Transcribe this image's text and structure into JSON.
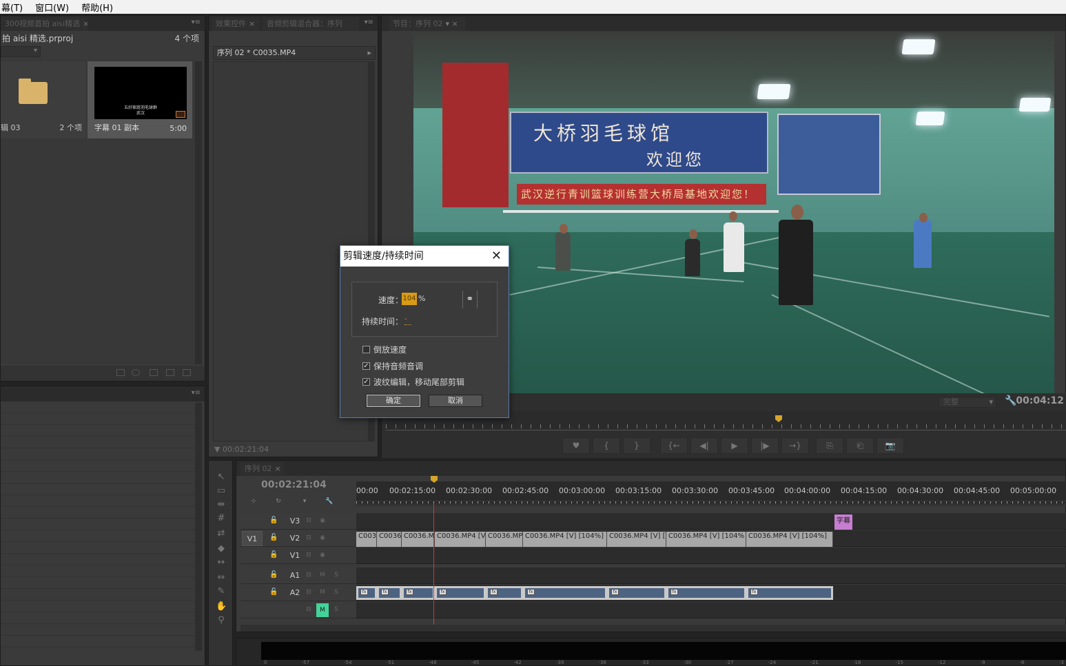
{
  "menubar": {
    "items": [
      "幕(T)",
      "窗口(W)",
      "帮助(H)"
    ]
  },
  "project": {
    "tab_label": "300视频首拍 aisi精选",
    "file_name": "拍 aisi 精选.prproj",
    "item_count": "4 个项",
    "bin": {
      "name": "辑 03",
      "count": "2 个项"
    },
    "clip": {
      "name": "字幕 01 副本",
      "duration": "5:00",
      "thumb_text_line1": "五好家庭羽毛球群",
      "thumb_text_line2": "武汉"
    }
  },
  "effects": {
    "tabs": [
      "效果控件",
      "音频剪辑混合器：序列"
    ],
    "header": "序列 02 * C0035.MP4",
    "time": "00:02:21:04"
  },
  "program": {
    "tab_label": "节目：序列 02",
    "fit": "完整",
    "timecode": "00:04:12",
    "scene": {
      "banner_line1": "大桥羽毛球馆",
      "banner_line2": "欢迎您",
      "red_banner": "武汉逆行青训篮球训练营大桥局基地欢迎您！"
    },
    "buttons": [
      "♥",
      "{",
      "}",
      "{←",
      "◀|",
      "▶",
      "|▶",
      "→}",
      "⎘",
      "⎗",
      "📷"
    ]
  },
  "timeline": {
    "tab_label": "序列 02",
    "timecode": "00:02:21:04",
    "ruler": [
      "00:00",
      "00:02:15:00",
      "00:02:30:00",
      "00:02:45:00",
      "00:03:00:00",
      "00:03:15:00",
      "00:03:30:00",
      "00:03:45:00",
      "00:04:00:00",
      "00:04:15:00",
      "00:04:30:00",
      "00:04:45:00",
      "00:05:00:00"
    ],
    "tracks": [
      {
        "name": "V3",
        "source": "",
        "kind": "video"
      },
      {
        "name": "V2",
        "source": "V1",
        "kind": "video"
      },
      {
        "name": "V1",
        "source": "",
        "kind": "video"
      },
      {
        "name": "A1",
        "source": "",
        "kind": "audio"
      },
      {
        "name": "A2",
        "source": "",
        "kind": "audio"
      },
      {
        "name": "",
        "source": "",
        "kind": "audio"
      }
    ],
    "title_clip": "字幕",
    "video_clips": [
      "C003",
      "C0036",
      "C0036.M",
      "C0036.MP4 [V",
      "C0036.MP",
      "C0036.MP4 [V] [104%]",
      "C0036.MP4 [V] [",
      "C0036.MP4 [V] [104%",
      "C0036.MP4 [V] [104%]"
    ],
    "fx_label": "fx",
    "toggle_m": "M",
    "toggle_s": "S",
    "meter_scale": [
      "0",
      "-57",
      "-54",
      "-51",
      "-48",
      "-45",
      "-42",
      "-39",
      "-36",
      "-33",
      "-30",
      "-27",
      "-24",
      "-21",
      "-18",
      "-15",
      "-12",
      "-9",
      "-6",
      "-3"
    ]
  },
  "dialog": {
    "title": "剪辑速度/持续时间",
    "speed_label": "速度：",
    "speed_value": "104",
    "percent": "%",
    "duration_label": "持续时间：",
    "duration_value": "-",
    "reverse_label": "倒放速度",
    "reverse_checked": false,
    "maintain_pitch_label": "保持音频音调",
    "maintain_pitch_checked": true,
    "ripple_label": "波纹编辑，移动尾部剪辑",
    "ripple_checked": true,
    "ok_label": "确定",
    "cancel_label": "取消"
  }
}
